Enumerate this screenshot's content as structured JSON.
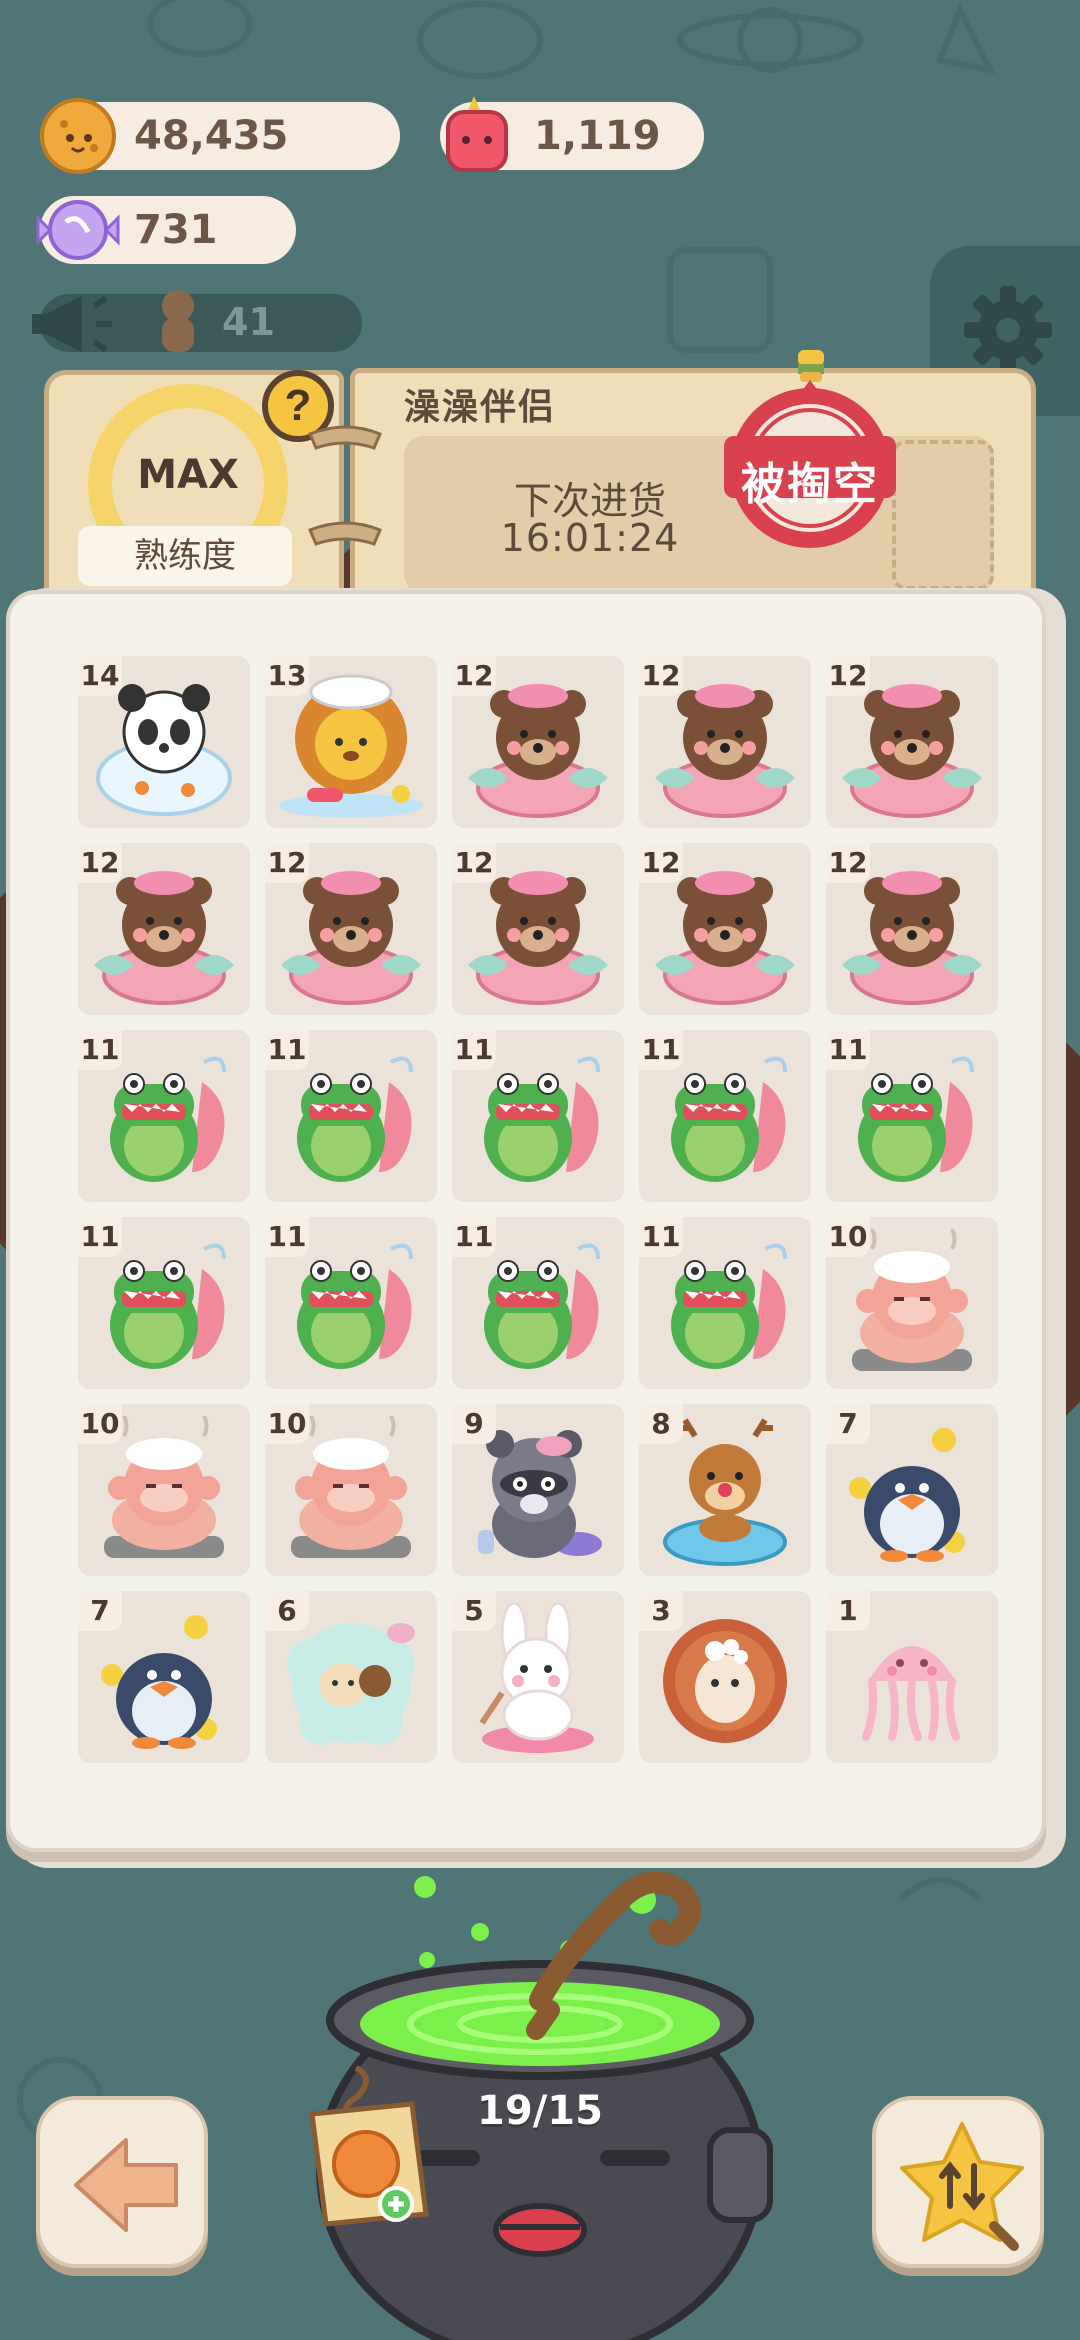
{
  "currencies": {
    "coins": "48,435",
    "jam": "1,119",
    "candy": "731",
    "visitors": "41"
  },
  "shop": {
    "title": "澡澡伴侣",
    "restock_label": "下次进货",
    "restock_time": "16:01:24",
    "stamp_text": "被掏空"
  },
  "proficiency": {
    "level": "MAX",
    "label": "熟练度",
    "help": "?"
  },
  "cauldron": {
    "counter": "19/15"
  },
  "items": [
    {
      "level": "14",
      "pet": "panda"
    },
    {
      "level": "13",
      "pet": "lion"
    },
    {
      "level": "12",
      "pet": "bear"
    },
    {
      "level": "12",
      "pet": "bear"
    },
    {
      "level": "12",
      "pet": "bear"
    },
    {
      "level": "12",
      "pet": "bear"
    },
    {
      "level": "12",
      "pet": "bear"
    },
    {
      "level": "12",
      "pet": "bear"
    },
    {
      "level": "12",
      "pet": "bear"
    },
    {
      "level": "12",
      "pet": "bear"
    },
    {
      "level": "11",
      "pet": "crocodile"
    },
    {
      "level": "11",
      "pet": "crocodile"
    },
    {
      "level": "11",
      "pet": "crocodile"
    },
    {
      "level": "11",
      "pet": "crocodile"
    },
    {
      "level": "11",
      "pet": "crocodile"
    },
    {
      "level": "11",
      "pet": "crocodile"
    },
    {
      "level": "11",
      "pet": "crocodile"
    },
    {
      "level": "11",
      "pet": "crocodile"
    },
    {
      "level": "11",
      "pet": "crocodile"
    },
    {
      "level": "10",
      "pet": "monkey"
    },
    {
      "level": "10",
      "pet": "monkey"
    },
    {
      "level": "10",
      "pet": "monkey"
    },
    {
      "level": "9",
      "pet": "raccoon"
    },
    {
      "level": "8",
      "pet": "deer"
    },
    {
      "level": "7",
      "pet": "penguin"
    },
    {
      "level": "7",
      "pet": "penguin"
    },
    {
      "level": "6",
      "pet": "sheep"
    },
    {
      "level": "5",
      "pet": "bunny"
    },
    {
      "level": "3",
      "pet": "hedgehog"
    },
    {
      "level": "1",
      "pet": "jellyfish"
    }
  ]
}
